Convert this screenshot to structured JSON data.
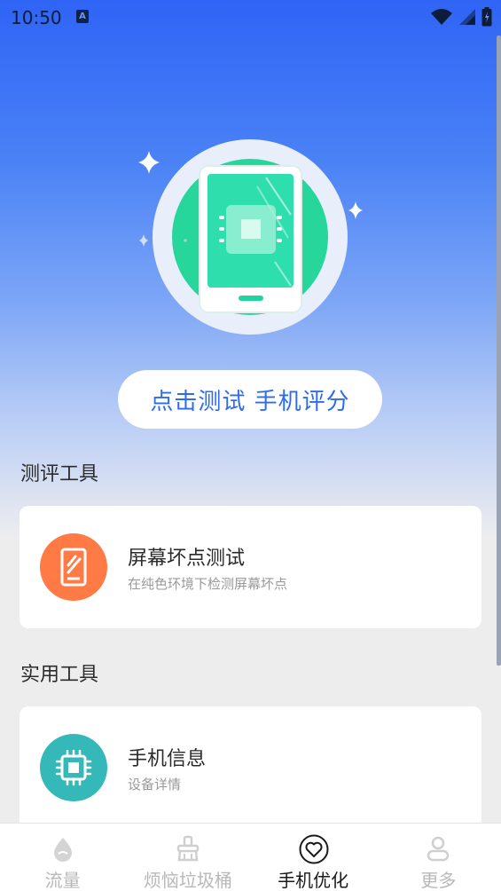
{
  "status_bar": {
    "time": "10:50",
    "icons": [
      "a-notification-icon",
      "wifi-icon",
      "signal-icon",
      "battery-icon"
    ]
  },
  "hero": {
    "illustration": "phone-chip-icon",
    "button_label": "点击测试 手机评分"
  },
  "sections": [
    {
      "title": "测评工具",
      "cards": [
        {
          "title": "屏幕坏点测试",
          "subtitle": "在纯色环境下检测屏幕坏点",
          "icon": "phone-screen-icon",
          "color": "#ff7a45"
        }
      ]
    },
    {
      "title": "实用工具",
      "cards": [
        {
          "title": "手机信息",
          "subtitle": "设备详情",
          "icon": "chip-icon",
          "color": "#35b8b8"
        }
      ]
    }
  ],
  "bottom_nav": {
    "items": [
      {
        "label": "流量",
        "icon": "drop-icon",
        "active": false
      },
      {
        "label": "烦恼垃圾桶",
        "icon": "broom-icon",
        "active": false
      },
      {
        "label": "手机优化",
        "icon": "heart-icon",
        "active": true
      },
      {
        "label": "更多",
        "icon": "person-icon",
        "active": false
      }
    ]
  },
  "colors": {
    "accent": "#2d6cf2",
    "hero_green": "#26d69b",
    "background": "#ededee"
  }
}
